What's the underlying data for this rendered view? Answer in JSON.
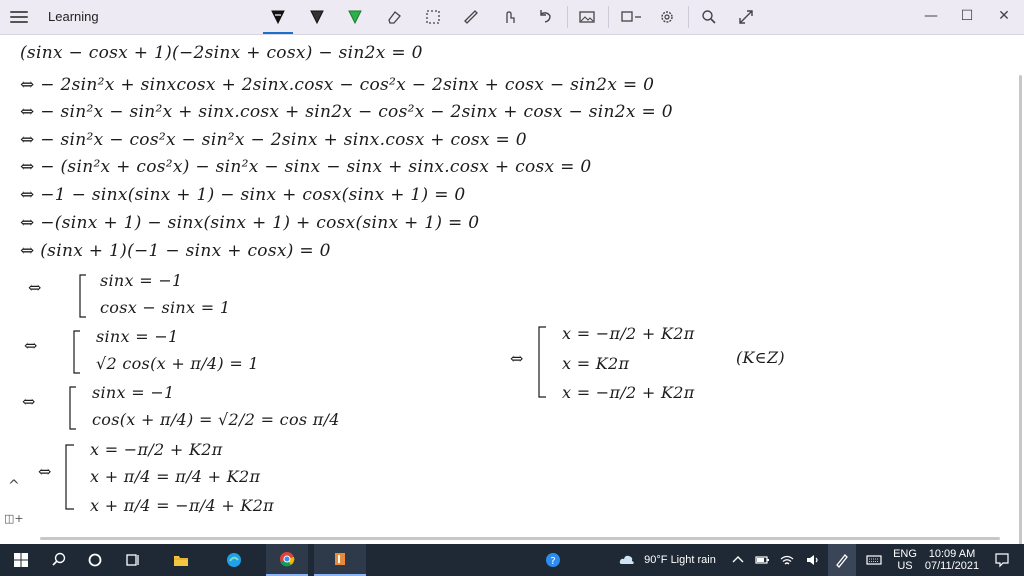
{
  "app": {
    "title": "Learning"
  },
  "toolbar": {
    "tools": [
      {
        "name": "pen-black"
      },
      {
        "name": "pen-dark"
      },
      {
        "name": "highlighter-green"
      },
      {
        "name": "eraser"
      },
      {
        "name": "lasso-select"
      },
      {
        "name": "ruler"
      },
      {
        "name": "touch-writing"
      },
      {
        "name": "undo"
      },
      {
        "name": "image"
      },
      {
        "name": "insert-shape"
      },
      {
        "name": "settings"
      },
      {
        "name": "zoom"
      },
      {
        "name": "fullscreen"
      }
    ]
  },
  "window": {
    "minimize": "—",
    "maximize": "☐",
    "close": "✕"
  },
  "notes": {
    "lines": [
      "(sinx − cosx + 1)(−2sinx + cosx) − sin2x = 0",
      "⇔ − 2sin²x + sinxcosx + 2sinx.cosx − cos²x − 2sinx + cosx − sin2x = 0",
      "⇔ − sin²x − sin²x + sinx.cosx + sin2x − cos²x − 2sinx + cosx − sin2x = 0",
      "⇔ − sin²x − cos²x − sin²x − 2sinx + sinx.cosx + cosx = 0",
      "⇔ − (sin²x + cos²x) − sin²x − sinx − sinx + sinx.cosx + cosx = 0",
      "⇔        −1 − sinx(sinx + 1) − sinx + cosx(sinx + 1) = 0",
      "⇔       −(sinx + 1) − sinx(sinx + 1) + cosx(sinx + 1) = 0",
      "⇔         (sinx + 1)(−1 − sinx + cosx) = 0"
    ],
    "case1": [
      "sinx = −1",
      "cosx − sinx = 1"
    ],
    "case2": [
      "sinx = −1",
      "√2 cos(x + π/4) = 1"
    ],
    "case3": [
      "sinx = −1",
      "cos(x + π/4) = √2/2 = cos π/4"
    ],
    "case4": [
      "x = −π/2 + K2π",
      "x + π/4 = π/4 + K2π",
      "x + π/4 = −π/4 + K2π"
    ],
    "result": [
      "x = −π/2 + K2π",
      "x = K2π",
      "x = −π/2 + K2π"
    ],
    "result_note": "(K∈Z)",
    "equiv": "⇔"
  },
  "canvas": {
    "collapse": "^",
    "sidebar_toggle": "◫+"
  },
  "taskbar": {
    "weather": "90°F  Light rain",
    "lang": "ENG",
    "region": "US",
    "time": "10:09 AM",
    "date": "07/11/2021"
  },
  "colors": {
    "titlebar": "#eeeaf3",
    "taskbar": "#1f2936",
    "accent": "#1a6fc9",
    "highlighter": "#2bb14a"
  }
}
